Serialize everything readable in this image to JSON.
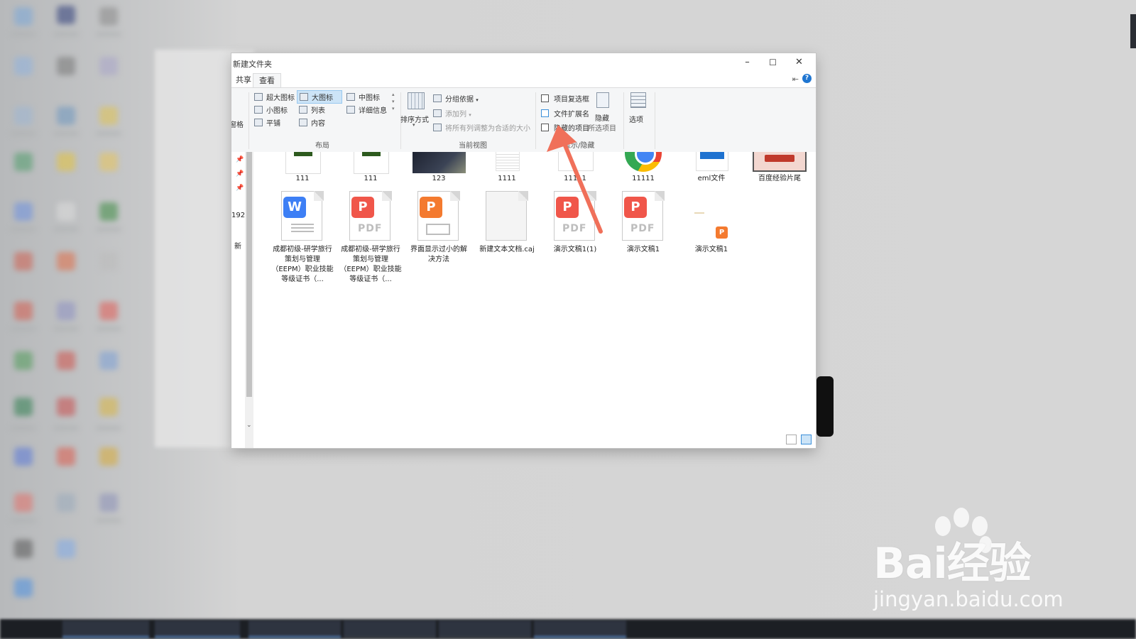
{
  "window": {
    "title": "新建文件夹",
    "minimize": "–",
    "maximize": "☐",
    "close": "✕",
    "help": "?",
    "pin": "⇤"
  },
  "tabs": [
    {
      "label": "共享"
    },
    {
      "label": "查看",
      "active": true
    }
  ],
  "ribbon": {
    "pane_fragment": "窗格",
    "layout": {
      "items": [
        "超大图标",
        "大图标",
        "中图标",
        "小图标",
        "列表",
        "详细信息",
        "平铺",
        "内容"
      ],
      "selected": "大图标",
      "group_label": "布局"
    },
    "current_view": {
      "sort": "排序方式",
      "group_by": "分组依据",
      "add_column": "添加列",
      "fit_columns": "将所有列调整为合适的大小",
      "group_label": "当前视图"
    },
    "show_hide": {
      "item_checkboxes": "项目复选框",
      "file_extensions": "文件扩展名",
      "hidden_items": "隐藏的项目",
      "hide_selected_line1": "隐藏",
      "hide_selected_line2": "所选项目",
      "group_label": "显示/隐藏"
    },
    "options": "选项"
  },
  "nav_fragments": [
    "192",
    "新"
  ],
  "files_row1": [
    {
      "name": "111"
    },
    {
      "name": "111"
    },
    {
      "name": "123"
    },
    {
      "name": "1111"
    },
    {
      "name": "11111"
    },
    {
      "name": "11111"
    },
    {
      "name": "eml文件"
    },
    {
      "name": "百度经验片尾"
    }
  ],
  "files_row2": [
    {
      "name": "成都初级-研学旅行策划与管理（EEPM）职业技能等级证书（...",
      "icon": "wps-writer-icon",
      "badge": "W",
      "color": "#3d7ff5"
    },
    {
      "name": "成都初级-研学旅行策划与管理（EEPM）职业技能等级证书（...",
      "icon": "pdf-icon",
      "badge": "P",
      "color": "#f0564a",
      "typetext": "PDF"
    },
    {
      "name": "界面显示过小的解决方法",
      "icon": "presentation-icon",
      "badge": "P",
      "color": "#f47a2f"
    },
    {
      "name": "新建文本文档.caj",
      "icon": "blank-file-icon"
    },
    {
      "name": "演示文稿1(1)",
      "icon": "pdf-icon",
      "badge": "P",
      "color": "#f0564a",
      "typetext": "PDF"
    },
    {
      "name": "演示文稿1",
      "icon": "pdf-icon",
      "badge": "P",
      "color": "#f0564a",
      "typetext": "PDF"
    },
    {
      "name": "演示文稿1",
      "icon": "presentation-thumb-icon",
      "badge": "P",
      "color": "#f47a2f"
    }
  ],
  "watermark": {
    "brand": "Bai经验",
    "url": "jingyan.baidu.com"
  },
  "colors": {
    "accent": "#3b8fd9",
    "arrow": "#f0705a",
    "pdf": "#f0564a",
    "word": "#3d7ff5",
    "ppt": "#f47a2f"
  }
}
